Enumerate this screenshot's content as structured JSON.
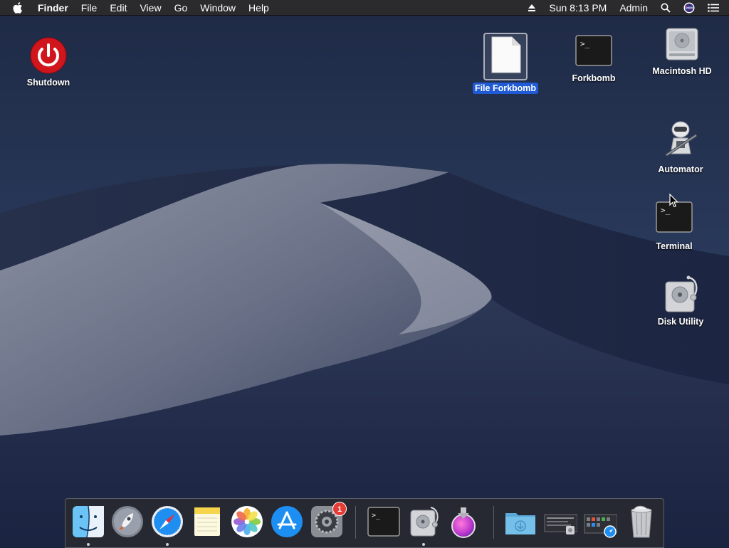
{
  "menubar": {
    "app_name": "Finder",
    "menus": [
      "File",
      "Edit",
      "View",
      "Go",
      "Window",
      "Help"
    ],
    "clock": "Sun 8:13 PM",
    "user": "Admin",
    "icons": [
      "apple-icon",
      "eject-icon",
      "spotlight-search-icon",
      "siri-icon",
      "notification-center-icon"
    ]
  },
  "desktop": {
    "shutdown": "Shutdown",
    "file_forkbomb": "File Forkbomb",
    "forkbomb": "Forkbomb",
    "macintosh_hd": "Macintosh HD",
    "automator": "Automator",
    "terminal": "Terminal",
    "disk_utility": "Disk Utility",
    "selected": "File Forkbomb"
  },
  "dock": {
    "items": [
      "Finder",
      "Launchpad",
      "Safari",
      "Notes",
      "Photos",
      "App Store",
      "System Preferences",
      "Terminal",
      "Disk Utility",
      "Installer",
      "Downloads",
      "Recent Documents",
      "Applications",
      "Trash"
    ],
    "running": [
      "Finder",
      "Safari",
      "Disk Utility"
    ],
    "system_preferences_badge": "1"
  },
  "colors": {
    "selection": "#1f5bd6",
    "badge": "#e53b35",
    "shutdown_red": "#d0151c"
  }
}
